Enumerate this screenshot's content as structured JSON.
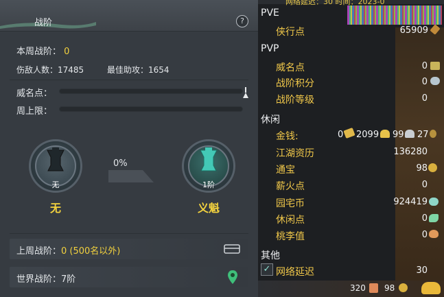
{
  "left": {
    "title": "战阶",
    "help": "?",
    "weekly_label": "本周战阶：",
    "weekly_value": "0",
    "kills_label": "伤敌人数：",
    "kills_value": "17485",
    "assist_label": "最佳助攻：",
    "assist_value": "1654",
    "fame_label": "威名点：",
    "weekly_cap_label": "周上限：",
    "progress_pct": "0%",
    "current_medal": {
      "badge": "无",
      "name": "无"
    },
    "next_medal": {
      "badge": "1阶",
      "name": "义魁"
    },
    "last_week_label": "上周战阶：",
    "last_week_value": "0 (500名以外)",
    "world_label": "世界战阶：",
    "world_value": "7阶"
  },
  "right": {
    "top_text": "网络延迟：30   时间：2023-0",
    "pve": {
      "title": "PVE",
      "xiaxing_label": "侠行点",
      "xiaxing_value": "65909"
    },
    "pvp": {
      "title": "PVP",
      "weiming_label": "威名点",
      "weiming_value": "0",
      "zhanjie_score_label": "战阶积分",
      "zhanjie_score_value": "0",
      "zhanjie_level_label": "战阶等级",
      "zhanjie_level_value": "0"
    },
    "leisure": {
      "title": "休闲",
      "money_label": "金钱:",
      "money_zhuan": "0",
      "money_jin": "2099",
      "money_yin": "99",
      "money_tong": "27",
      "jianghu_label": "江湖资历",
      "jianghu_value": "136280",
      "tongbao_label": "通宝",
      "tongbao_value": "98",
      "xinhuo_label": "薪火点",
      "xinhuo_value": "0",
      "yuanzhai_label": "园宅币",
      "yuanzhai_value": "924419",
      "xiuxian_label": "休闲点",
      "xiuxian_value": "0",
      "taoli_label": "桃李值",
      "taoli_value": "0"
    },
    "other": {
      "title": "其他",
      "latency_label": "网络延迟",
      "latency_value": "30",
      "latency_checked": true
    }
  },
  "bottom": {
    "value_a": "320",
    "value_b": "98"
  },
  "colors": {
    "accent_yellow": "#f3d23e",
    "item_gold": "#f1c84a"
  }
}
